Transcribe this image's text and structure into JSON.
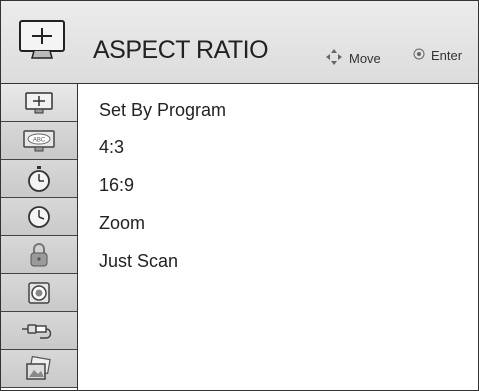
{
  "header": {
    "title": "ASPECT RATIO",
    "icon": "picture-monitor-icon",
    "hints": [
      {
        "icon": "four-way-arrows-icon",
        "label": "Move"
      },
      {
        "icon": "enter-circle-icon",
        "label": "Enter"
      }
    ]
  },
  "sidebar": {
    "items": [
      {
        "icon": "picture-monitor-icon",
        "active": true
      },
      {
        "icon": "abc-caption-icon"
      },
      {
        "icon": "sleep-timer-icon"
      },
      {
        "icon": "clock-icon"
      },
      {
        "icon": "lock-icon"
      },
      {
        "icon": "speaker-icon"
      },
      {
        "icon": "input-plug-icon"
      },
      {
        "icon": "photo-icon"
      }
    ]
  },
  "options": [
    {
      "label": "Set By Program"
    },
    {
      "label": "4:3"
    },
    {
      "label": "16:9"
    },
    {
      "label": "Zoom"
    },
    {
      "label": "Just Scan"
    }
  ]
}
